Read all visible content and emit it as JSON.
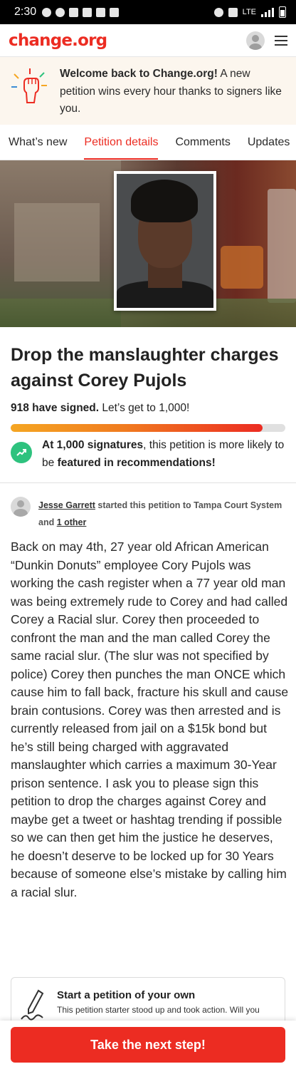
{
  "status_bar": {
    "time": "2:30",
    "network": "LTE"
  },
  "header": {
    "logo": "change.org"
  },
  "welcome": {
    "bold": "Welcome back to Change.org!",
    "text": " A new petition wins every hour thanks to signers like you."
  },
  "tabs": [
    {
      "label": "What’s new"
    },
    {
      "label": "Petition details"
    },
    {
      "label": "Comments"
    },
    {
      "label": "Updates"
    }
  ],
  "petition": {
    "title": "Drop the manslaughter charges against Corey Pujols",
    "signed_count": "918 have signed.",
    "goal_text": " Let’s get to 1,000!",
    "progress_fraction": 0.918,
    "milestone_bold1": "At 1,000 signatures",
    "milestone_mid": ", this petition is more likely to be ",
    "milestone_bold2": "featured in recommendations!",
    "starter_name": "Jesse Garrett",
    "starter_text": " started this petition to Tampa Court System and ",
    "starter_other": "1 other",
    "body": "Back on may 4th, 27 year old African American  “Dunkin Donuts” employee Cory Pujols was working the cash register when a 77 year old man was being extremely rude to Corey and had called Corey a Racial slur. Corey then proceeded to confront the man and the man called Corey the same racial slur. (The slur was not specified by police) Corey then punches the man ONCE which cause him to fall back, fracture his skull and cause brain contusions. Corey was then arrested and is currently released from jail on a $15k bond but he’s still being charged with aggravated manslaughter which carries a maximum 30-Year prison sentence. I ask you to please sign this petition to drop the charges against Corey and maybe get a tweet or hashtag trending if possible so we can then get him the justice he deserves, he doesn’t deserve to be locked up for 30 Years because of someone else’s mistake by calling him a racial slur."
  },
  "promo": {
    "title": "Start a petition of your own",
    "subtitle": "This petition starter stood up and took action. Will you"
  },
  "cta": {
    "label": "Take the next step!"
  },
  "colors": {
    "brand": "#ec2c22",
    "milestone": "#2ec27e"
  }
}
